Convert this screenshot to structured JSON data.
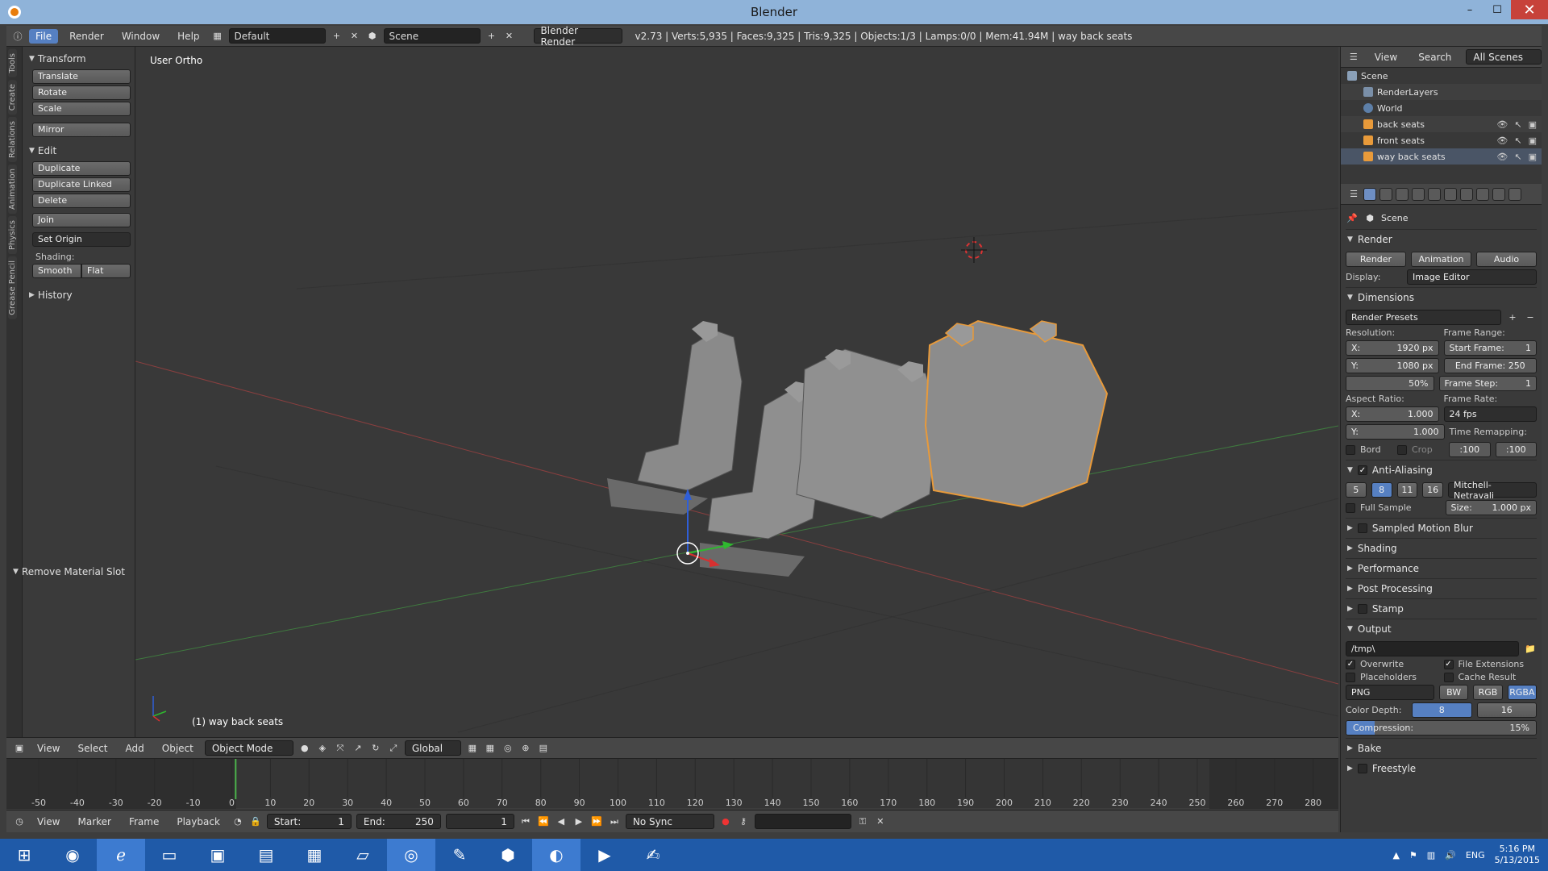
{
  "window": {
    "title": "Blender",
    "min": "–",
    "max": "☐",
    "close": "✕"
  },
  "infobar": {
    "menus": [
      "File",
      "Render",
      "Window",
      "Help"
    ],
    "layout": "Default",
    "scene": "Scene",
    "engine": "Blender Render",
    "stats": "v2.73 | Verts:5,935 | Faces:9,325 | Tris:9,325 | Objects:1/3 | Lamps:0/0 | Mem:41.94M | way back seats"
  },
  "toolshelf": {
    "tabs": [
      "Tools",
      "Create",
      "Relations",
      "Animation",
      "Physics",
      "Grease Pencil"
    ],
    "transform": {
      "title": "Transform",
      "buttons": [
        "Translate",
        "Rotate",
        "Scale",
        "Mirror"
      ]
    },
    "edit": {
      "title": "Edit",
      "buttons": [
        "Duplicate",
        "Duplicate Linked",
        "Delete",
        "Join",
        "Set Origin"
      ],
      "shading_label": "Shading:",
      "smooth": "Smooth",
      "flat": "Flat"
    },
    "history": "History",
    "operator": "Remove Material Slot"
  },
  "viewport": {
    "name": "User Ortho",
    "object_label": "(1) way back seats",
    "seats": [
      {
        "name": "front seats",
        "selected": false
      },
      {
        "name": "back seats",
        "selected": false
      },
      {
        "name": "way back seats",
        "selected": true
      }
    ],
    "header": {
      "menus": [
        "View",
        "Select",
        "Add",
        "Object"
      ],
      "mode": "Object Mode",
      "orientation": "Global"
    }
  },
  "timeline": {
    "ticks": [
      "-50",
      "-40",
      "-30",
      "-20",
      "-10",
      "0",
      "10",
      "20",
      "30",
      "40",
      "50",
      "60",
      "70",
      "80",
      "90",
      "100",
      "110",
      "120",
      "130",
      "140",
      "150",
      "160",
      "170",
      "180",
      "190",
      "200",
      "210",
      "220",
      "230",
      "240",
      "250",
      "260",
      "270",
      "280"
    ],
    "current_frame": 1,
    "header": {
      "menus": [
        "View",
        "Marker",
        "Frame",
        "Playback"
      ],
      "start": "Start:",
      "start_val": "1",
      "end": "End:",
      "end_val": "250",
      "frame": "1",
      "sync": "No Sync"
    }
  },
  "outliner": {
    "menus": [
      "View",
      "Search"
    ],
    "scope": "All Scenes",
    "items": [
      {
        "label": "Scene",
        "indent": 0
      },
      {
        "label": "RenderLayers",
        "indent": 1
      },
      {
        "label": "World",
        "indent": 1
      },
      {
        "label": "back seats",
        "indent": 1
      },
      {
        "label": "front seats",
        "indent": 1
      },
      {
        "label": "way back seats",
        "indent": 1
      }
    ]
  },
  "properties": {
    "context": "Scene",
    "render_section": "Render",
    "render_btns": [
      "Render",
      "Animation",
      "Audio"
    ],
    "display_label": "Display:",
    "display_value": "Image Editor",
    "dimensions": "Dimensions",
    "presets": "Render Presets",
    "resolution": "Resolution:",
    "res_x": "X:",
    "res_x_val": "1920 px",
    "res_y": "Y:",
    "res_y_val": "1080 px",
    "res_pct": "50%",
    "frame_range": "Frame Range:",
    "start_frame": "Start Frame:",
    "start_frame_val": "1",
    "end_frame": "End Frame: 250",
    "frame_step": "Frame Step:",
    "frame_step_val": "1",
    "aspect": "Aspect Ratio:",
    "aspect_x": "X:",
    "aspect_x_val": "1.000",
    "aspect_y": "Y:",
    "aspect_y_val": "1.000",
    "frame_rate": "Frame Rate:",
    "fps": "24 fps",
    "time_remap": "Time Remapping:",
    "remap_old": ":100",
    "remap_new": ":100",
    "bord": "Bord",
    "crop": "Crop",
    "aa": "Anti-Aliasing",
    "aa_samples": [
      "5",
      "8",
      "11",
      "16"
    ],
    "aa_filter": "Mitchell-Netravali",
    "full_sample": "Full Sample",
    "aa_size": "Size:",
    "aa_size_val": "1.000 px",
    "collapsed": [
      "Sampled Motion Blur",
      "Shading",
      "Performance",
      "Post Processing",
      "Stamp"
    ],
    "output": "Output",
    "path": "/tmp\\",
    "overwrite": "Overwrite",
    "file_ext": "File Extensions",
    "placeholders": "Placeholders",
    "cache": "Cache Result",
    "format": "PNG",
    "color_modes": [
      "BW",
      "RGB",
      "RGBA"
    ],
    "color_depth": "Color Depth:",
    "depths": [
      "8",
      "16"
    ],
    "compression": "Compression:",
    "compression_val": "15%",
    "compression_level": 0.15,
    "bake": "Bake",
    "freestyle": "Freestyle"
  },
  "taskbar": {
    "lang": "ENG",
    "time": "5:16 PM",
    "date": "5/13/2015"
  }
}
